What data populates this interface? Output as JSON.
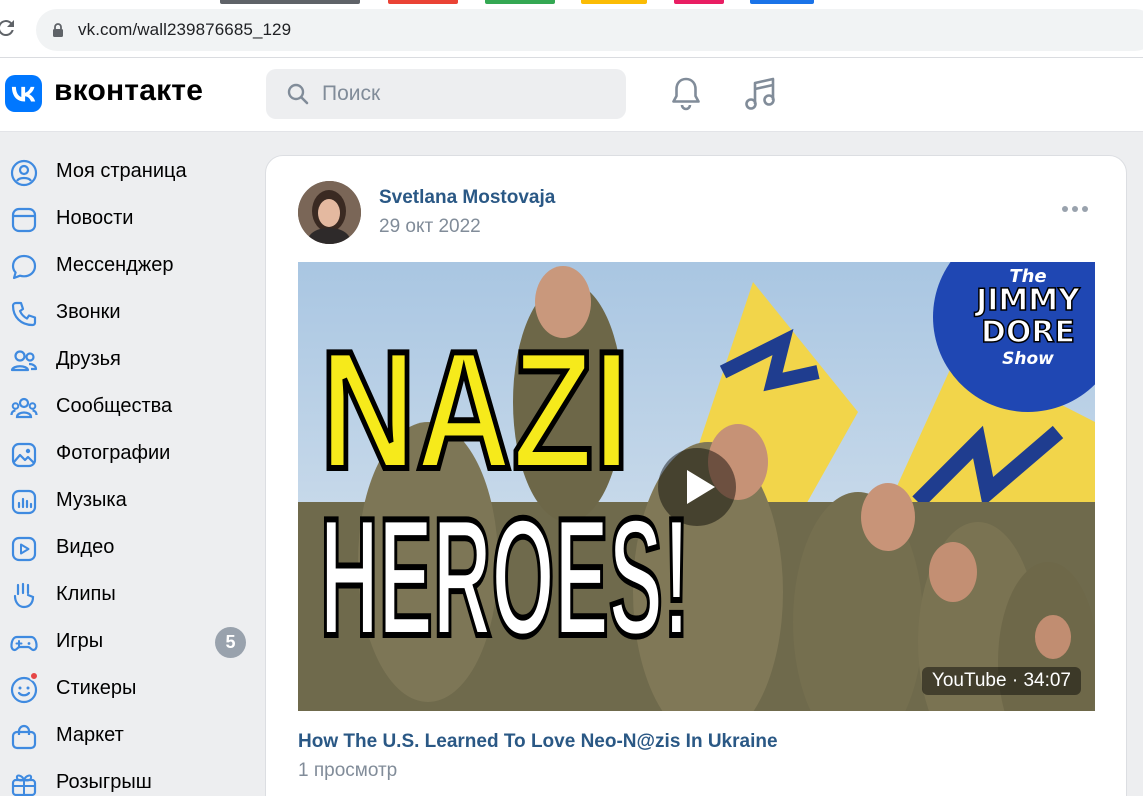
{
  "browser": {
    "url": "vk.com/wall239876685_129",
    "tab_colors": [
      "#5f6368",
      "#ea4335",
      "#34a853",
      "#fbbc04",
      "#e91e63",
      "#1a73e8"
    ]
  },
  "header": {
    "logo_text": "вконтакте",
    "search_placeholder": "Поиск",
    "brand_color": "#0077ff"
  },
  "sidebar": {
    "items": [
      {
        "label": "Моя страница",
        "icon": "user-circle-icon"
      },
      {
        "label": "Новости",
        "icon": "news-icon"
      },
      {
        "label": "Мессенджер",
        "icon": "message-icon"
      },
      {
        "label": "Звонки",
        "icon": "phone-icon"
      },
      {
        "label": "Друзья",
        "icon": "friends-icon"
      },
      {
        "label": "Сообщества",
        "icon": "communities-icon"
      },
      {
        "label": "Фотографии",
        "icon": "photo-icon"
      },
      {
        "label": "Музыка",
        "icon": "music-bars-icon"
      },
      {
        "label": "Видео",
        "icon": "video-icon"
      },
      {
        "label": "Клипы",
        "icon": "clips-icon"
      },
      {
        "label": "Игры",
        "icon": "gamepad-icon",
        "badge": "5"
      },
      {
        "label": "Стикеры",
        "icon": "smile-icon"
      },
      {
        "label": "Маркет",
        "icon": "bag-icon"
      },
      {
        "label": "Розыгрыш",
        "icon": "gift-icon"
      }
    ]
  },
  "post": {
    "author": "Svetlana Mostovaja",
    "date": "29 окт 2022",
    "video": {
      "thumbnail_text_1": "NAZI",
      "thumbnail_text_2": "HEROES!",
      "logo_line_1": "The",
      "logo_line_2": "JIMMY",
      "logo_line_3": "DORE",
      "logo_line_4": "Show",
      "duration": "YouTube · 34:07",
      "title": "How The U.S. Learned To Love Neo-N@zis In Ukraine",
      "views": "1 просмотр"
    }
  }
}
